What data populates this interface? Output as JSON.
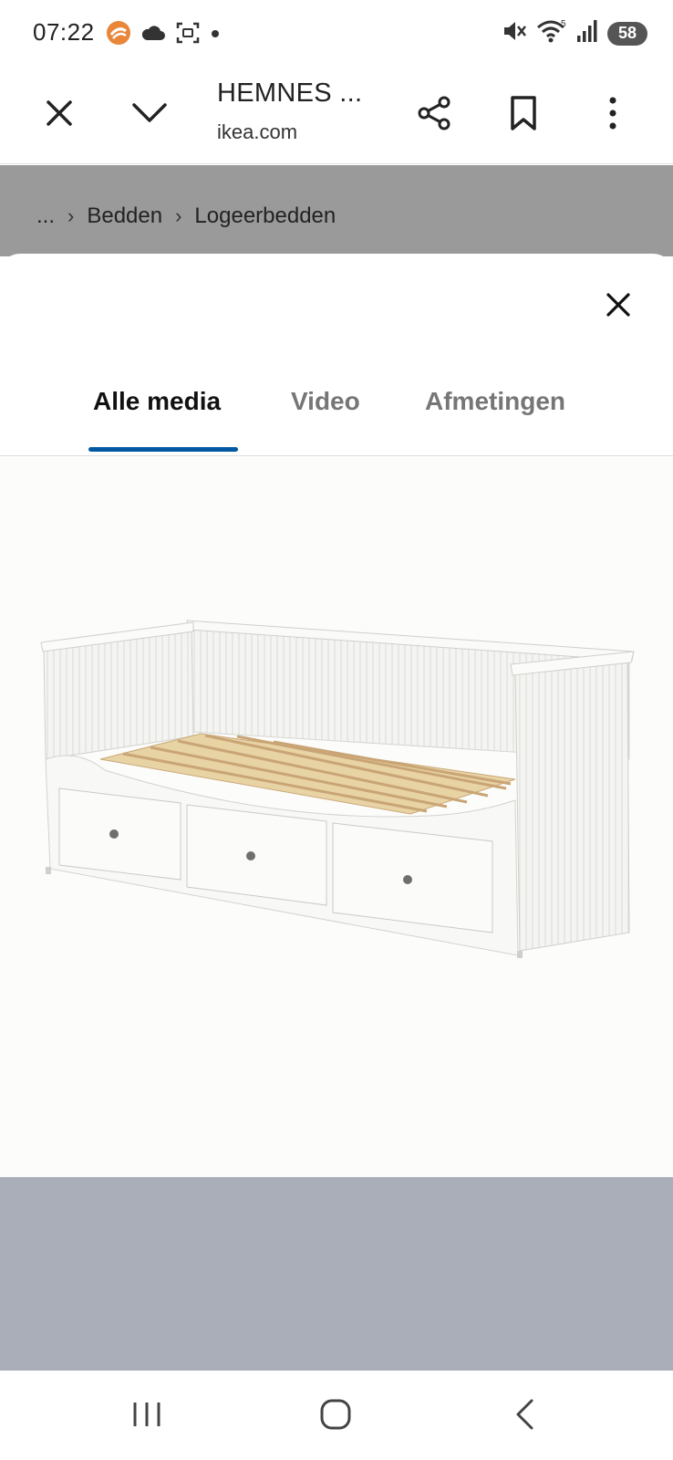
{
  "status_bar": {
    "time": "07:22",
    "battery_level": "58",
    "icons": [
      "notification-app-icon",
      "cloud-icon",
      "screenshot-icon",
      "dot-icon",
      "mute-icon",
      "wifi-icon",
      "signal-icon",
      "battery-icon"
    ]
  },
  "browser": {
    "page_title": "HEMNES ...",
    "domain": "ikea.com",
    "icons": [
      "close-icon",
      "chevron-down-icon",
      "share-icon",
      "bookmark-icon",
      "more-vert-icon"
    ]
  },
  "breadcrumb": {
    "items": [
      "...",
      "Bedden",
      "Logeerbedden"
    ]
  },
  "modal": {
    "tabs": [
      {
        "label": "Alle media",
        "active": true
      },
      {
        "label": "Video",
        "active": false
      },
      {
        "label": "Afmetingen",
        "active": false
      }
    ],
    "accent_color": "#0058a3",
    "image_subject": "white daybed with three drawers and wooden slats"
  },
  "nav_bar": {
    "icons": [
      "recent-apps-icon",
      "home-icon",
      "back-icon"
    ]
  }
}
